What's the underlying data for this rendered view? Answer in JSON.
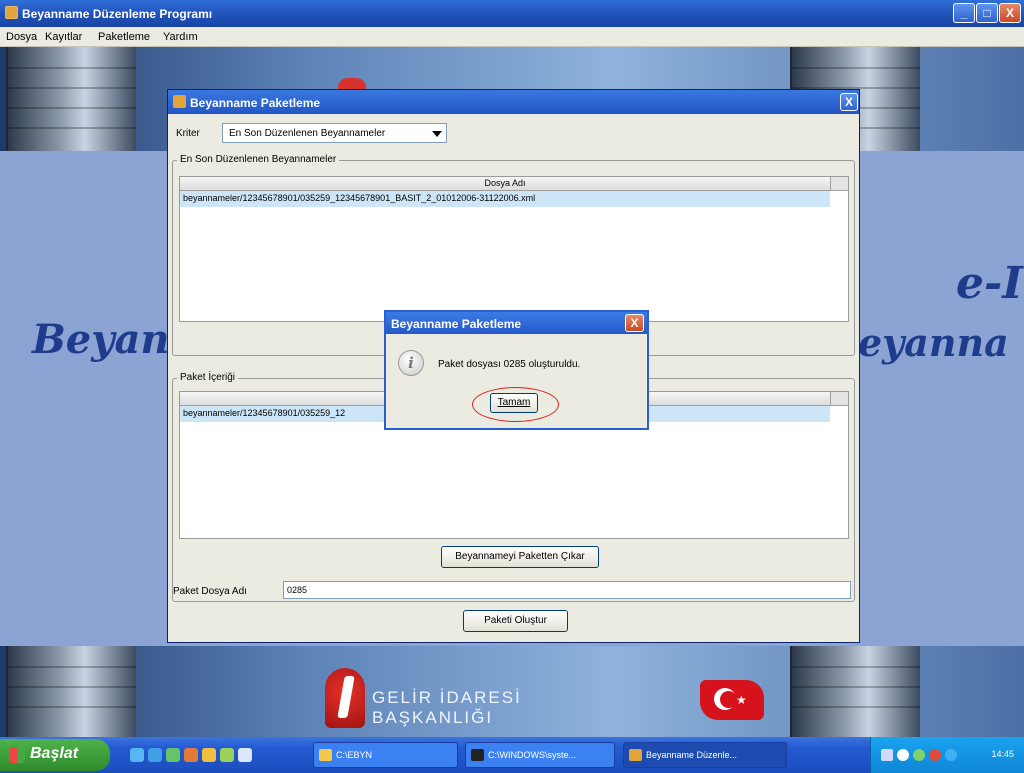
{
  "window": {
    "title": "Beyanname Düzenleme Programı",
    "controls": {
      "minimize": "_",
      "maximize": "□",
      "close": "X"
    }
  },
  "menu": [
    "Dosya",
    "Kayıtlar",
    "Paketleme",
    "Yardım"
  ],
  "background": {
    "left_text": "Beyan",
    "right_text_top": "e-I",
    "right_text_bottom": "eyanna",
    "logo_line1": "GELİR İDARESİ",
    "logo_line2": "BAŞKANLIĞI"
  },
  "packaging_window": {
    "title": "Beyanname Paketleme",
    "close": "X",
    "criteria_label": "Kriter",
    "criteria_value": "En Son Düzenlenen Beyannameler",
    "recent_group_title": "En Son Düzenlenen Beyannameler",
    "recent_table": {
      "header": "Dosya Adı",
      "rows": [
        "beyannameler/12345678901/035259_12345678901_BASIT_2_01012006-31122006.xml"
      ]
    },
    "package_group_title": "Paket İçeriği",
    "package_table": {
      "rows": [
        "beyannameler/12345678901/035259_12"
      ]
    },
    "remove_button": "Beyannameyi Paketten Çıkar",
    "package_file_label": "Paket Dosya Adı",
    "package_file_value": "0285",
    "create_button": "Paketi Oluştur"
  },
  "message_dialog": {
    "title": "Beyanname Paketleme",
    "close": "X",
    "icon": "i",
    "text": "Paket dosyası 0285 oluşturuldu.",
    "ok_button": "Tamam"
  },
  "taskbar": {
    "start_label": "Başlat",
    "tasks": [
      "C:\\EBYN",
      "C:\\WINDOWS\\syste...",
      "Beyanname Düzenle..."
    ],
    "clock": "14:45"
  }
}
